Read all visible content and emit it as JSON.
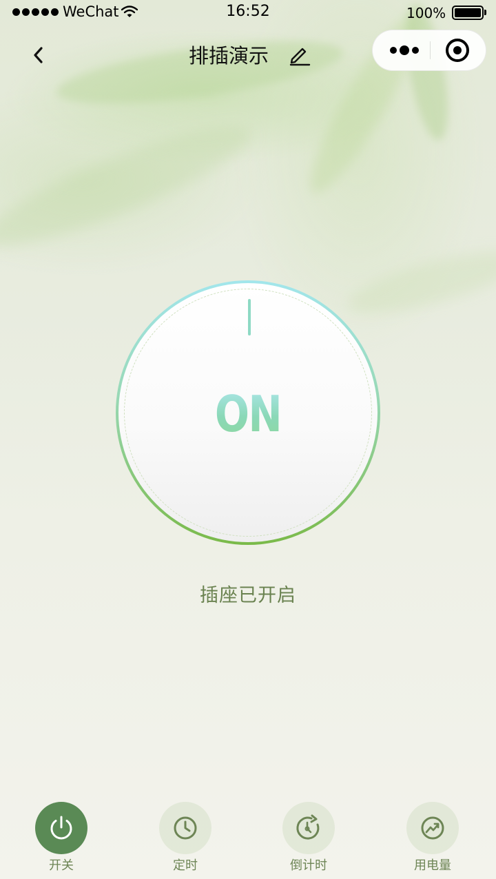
{
  "status_bar": {
    "carrier": "WeChat",
    "time": "16:52",
    "battery_percent": "100%"
  },
  "nav": {
    "title": "排插演示"
  },
  "dial": {
    "label": "ON",
    "state": "on"
  },
  "status_message": "插座已开启",
  "tabs": [
    {
      "label": "开关",
      "icon": "power-icon",
      "active": true
    },
    {
      "label": "定时",
      "icon": "clock-icon",
      "active": false
    },
    {
      "label": "倒计时",
      "icon": "countdown-icon",
      "active": false
    },
    {
      "label": "用电量",
      "icon": "chart-trend-icon",
      "active": false
    }
  ],
  "colors": {
    "accent_green": "#5a8a55",
    "status_text": "#6a8250",
    "dial_ring_top": "#a2e6ec",
    "dial_ring_bottom": "#7aba49"
  }
}
